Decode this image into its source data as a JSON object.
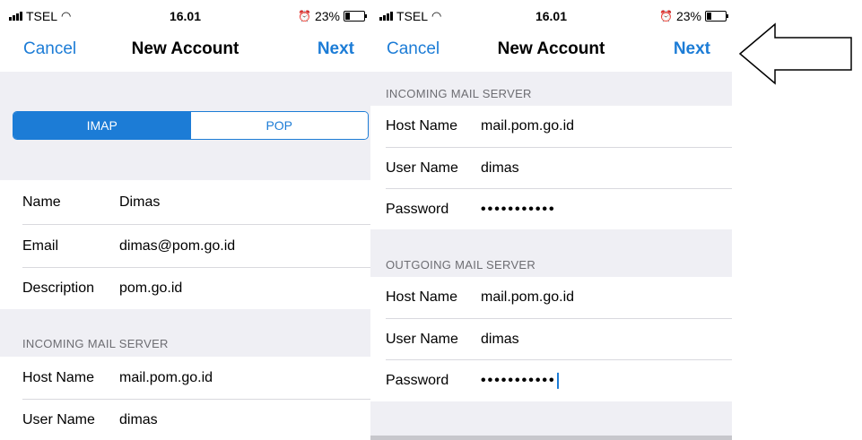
{
  "left": {
    "status": {
      "carrier": "TSEL",
      "time": "16.01",
      "battery": "23%",
      "battery_level": 0.23
    },
    "nav": {
      "cancel": "Cancel",
      "title": "New Account",
      "next": "Next"
    },
    "segments": [
      "IMAP",
      "POP"
    ],
    "selected_segment": "IMAP",
    "account": [
      {
        "label": "Name",
        "value": "Dimas"
      },
      {
        "label": "Email",
        "value": "dimas@pom.go.id"
      },
      {
        "label": "Description",
        "value": "pom.go.id"
      }
    ],
    "incoming_header": "INCOMING MAIL SERVER",
    "incoming": [
      {
        "label": "Host Name",
        "value": "mail.pom.go.id"
      },
      {
        "label": "User Name",
        "value": "dimas"
      }
    ]
  },
  "right": {
    "status": {
      "carrier": "TSEL",
      "time": "16.01",
      "battery": "23%",
      "battery_level": 0.23
    },
    "nav": {
      "cancel": "Cancel",
      "title": "New Account",
      "next": "Next"
    },
    "incoming_header": "INCOMING MAIL SERVER",
    "incoming": [
      {
        "label": "Host Name",
        "value": "mail.pom.go.id"
      },
      {
        "label": "User Name",
        "value": "dimas"
      },
      {
        "label": "Password",
        "value": "•••••••••••"
      }
    ],
    "outgoing_header": "OUTGOING MAIL SERVER",
    "outgoing": [
      {
        "label": "Host Name",
        "value": "mail.pom.go.id"
      },
      {
        "label": "User Name",
        "value": "dimas"
      },
      {
        "label": "Password",
        "value": "•••••••••••"
      }
    ]
  },
  "colors": {
    "accent": "#1c7cd6",
    "group_bg": "#efeff4",
    "separator": "#d9d9de",
    "header_text": "#6d6d72"
  },
  "icons": [
    "signal-icon",
    "wifi-icon",
    "alarm-icon",
    "battery-icon",
    "arrow-left-icon"
  ]
}
